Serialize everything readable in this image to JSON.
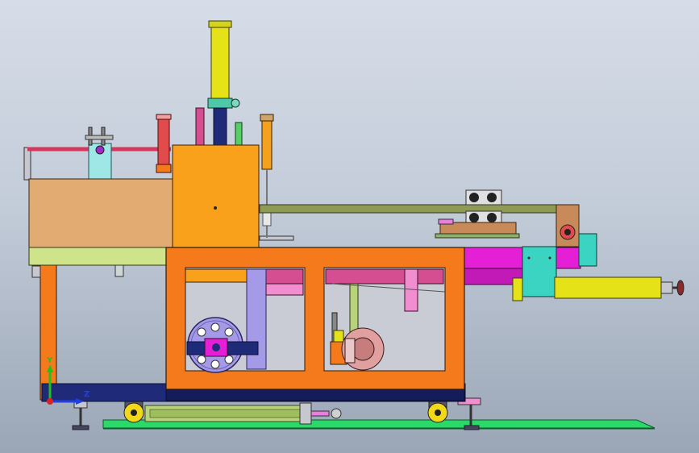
{
  "viewport": {
    "background_top": "#d6dde8",
    "background_bottom": "#9aa6b6"
  },
  "model": {
    "colors": {
      "frame_orange": "#f47a1c",
      "hopper_orange": "#f9a11a",
      "tan_box": "#e2ab72",
      "lime": "#cfe38a",
      "magenta": "#e51fd6",
      "pink": "#f08ed0",
      "teal": "#3bd4c3",
      "cyan_block": "#9fe6e6",
      "yellow_cylinder": "#e5e317",
      "lavender": "#a49ae8",
      "navy": "#1f2a78",
      "green_rail": "#2bd96a",
      "olive_arm": "#8f9a55",
      "salmon_motor": "#e0a0a0",
      "red_cylinder": "#e24b4b",
      "wheel_yellow": "#f1d91a",
      "olive_green": "#b8d37a",
      "brown_gear": "#c98a5a"
    },
    "icons": [
      "vertical-hydraulic-cylinder-icon",
      "flywheel-icon",
      "electric-motor-icon",
      "caster-wheel-icon",
      "handwheel-icon",
      "roller-assembly-icon"
    ]
  },
  "coordinate_triad": {
    "x_label": "",
    "y_label": "Y",
    "z_label": "Z",
    "colors": {
      "x": "#e02020",
      "y": "#20c020",
      "z": "#2040e0"
    }
  }
}
